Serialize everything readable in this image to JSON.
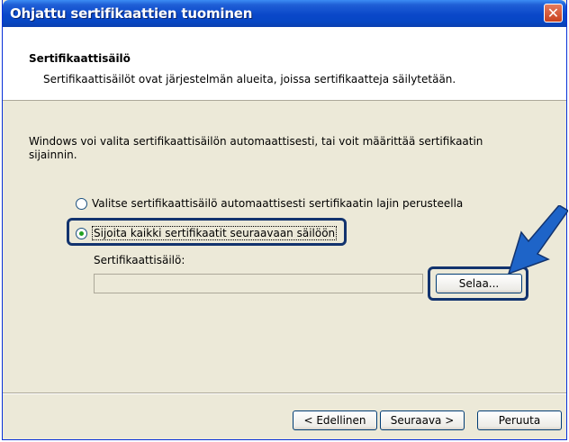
{
  "window": {
    "title": "Ohjattu sertifikaattien tuominen",
    "close_glyph": "✕"
  },
  "header": {
    "title": "Sertifikaattisäilö",
    "subtitle": "Sertifikaattisäilöt ovat järjestelmän alueita, joissa sertifikaatteja säilytetään."
  },
  "main": {
    "description": "Windows voi valita sertifikaattisäilön automaattisesti, tai voit määrittää sertifikaatin sijainnin.",
    "options": [
      {
        "label": "Valitse sertifikaattisäilö automaattisesti sertifikaatin lajin perusteella",
        "selected": false
      },
      {
        "label": "Sijoita kaikki sertifikaatit seuraavaan säilöön",
        "selected": true
      }
    ],
    "store_label": "Sertifikaattisäilö:",
    "store_value": "",
    "browse_label": "Selaa..."
  },
  "footer": {
    "back_label": "< Edellinen",
    "next_label": "Seuraava >",
    "cancel_label": "Peruuta"
  },
  "colors": {
    "titlebar": "#0A47C9",
    "annotation": "#12336E",
    "arrow": "#1E64C8",
    "dialog": "#ECE9D8"
  }
}
